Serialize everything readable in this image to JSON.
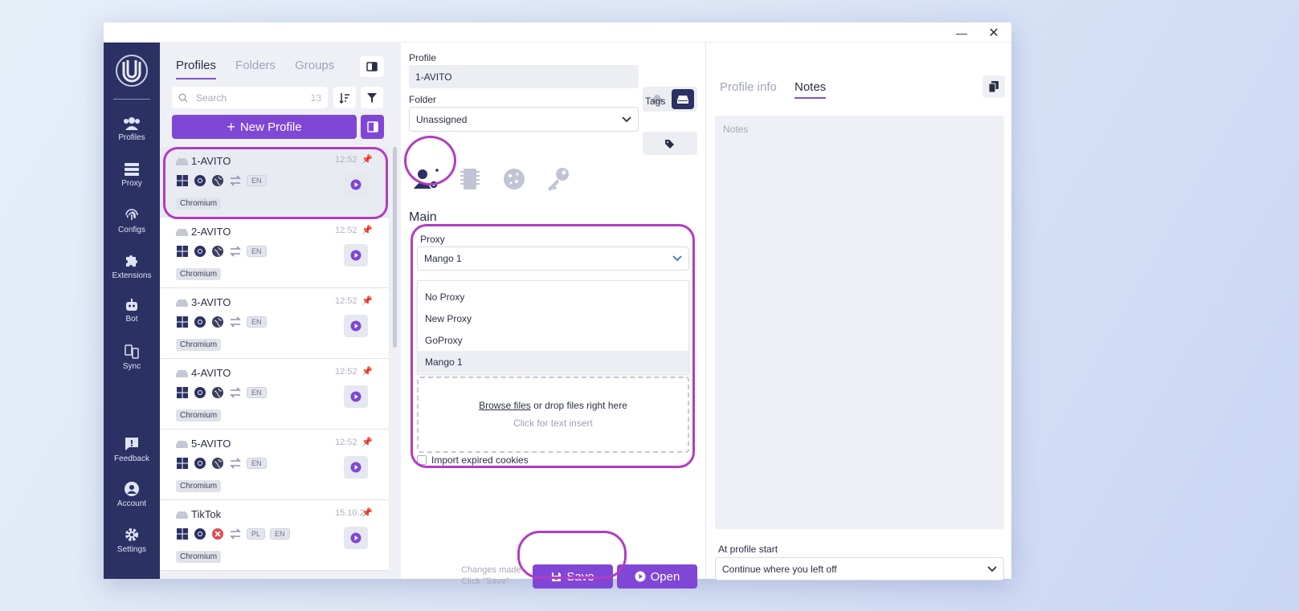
{
  "window": {
    "minimize": "—",
    "close": "✕"
  },
  "nav": {
    "items": [
      {
        "label": "Profiles",
        "icon": "users-icon"
      },
      {
        "label": "Proxy",
        "icon": "server-icon"
      },
      {
        "label": "Configs",
        "icon": "fingerprint-icon"
      },
      {
        "label": "Extensions",
        "icon": "puzzle-icon"
      },
      {
        "label": "Bot",
        "icon": "robot-icon"
      },
      {
        "label": "Sync",
        "icon": "sync-icon"
      }
    ],
    "bottom": [
      {
        "label": "Feedback",
        "icon": "feedback-icon"
      },
      {
        "label": "Account",
        "icon": "account-icon"
      },
      {
        "label": "Settings",
        "icon": "gear-icon"
      }
    ]
  },
  "list": {
    "tabs": [
      "Profiles",
      "Folders",
      "Groups"
    ],
    "search_placeholder": "Search",
    "search_count": "13",
    "new_profile": "New Profile",
    "profiles": [
      {
        "name": "1-AVITO",
        "time": "12:52",
        "lang": [
          "EN"
        ],
        "browser": "Chromium",
        "status": "ok"
      },
      {
        "name": "2-AVITO",
        "time": "12:52",
        "lang": [
          "EN"
        ],
        "browser": "Chromium",
        "status": "ok"
      },
      {
        "name": "3-AVITO",
        "time": "12:52",
        "lang": [
          "EN"
        ],
        "browser": "Chromium",
        "status": "ok"
      },
      {
        "name": "4-AVITO",
        "time": "12:52",
        "lang": [
          "EN"
        ],
        "browser": "Chromium",
        "status": "ok"
      },
      {
        "name": "5-AVITO",
        "time": "12:52",
        "lang": [
          "EN"
        ],
        "browser": "Chromium",
        "status": "ok"
      },
      {
        "name": "TikTok",
        "time": "15.10.24",
        "lang": [
          "PL",
          "EN"
        ],
        "browser": "Chromium",
        "status": "error"
      }
    ]
  },
  "editor": {
    "profile_label": "Profile",
    "profile_value": "1-AVITO",
    "folder_label": "Folder",
    "folder_value": "Unassigned",
    "tags_label": "Tags",
    "section_title": "Main",
    "proxy_label": "Proxy",
    "proxy_value": "Mango 1",
    "proxy_options": [
      "No Proxy",
      "New Proxy",
      "GoProxy",
      "Mango 1"
    ],
    "browse_files": "Browse files",
    "drop_text": "or drop files right here",
    "click_insert": "Click for text insert",
    "import_expired": "Import expired cookies",
    "changes_line1": "Changes made",
    "changes_line2": "Click \"Save\"",
    "save": "Save",
    "open": "Open"
  },
  "right": {
    "tabs": [
      "Profile info",
      "Notes"
    ],
    "notes_placeholder": "Notes",
    "start_label": "At profile start",
    "start_value": "Continue where you left off"
  },
  "colors": {
    "accent": "#8046d6",
    "nav": "#2b3163",
    "highlight": "#b23cc2"
  }
}
